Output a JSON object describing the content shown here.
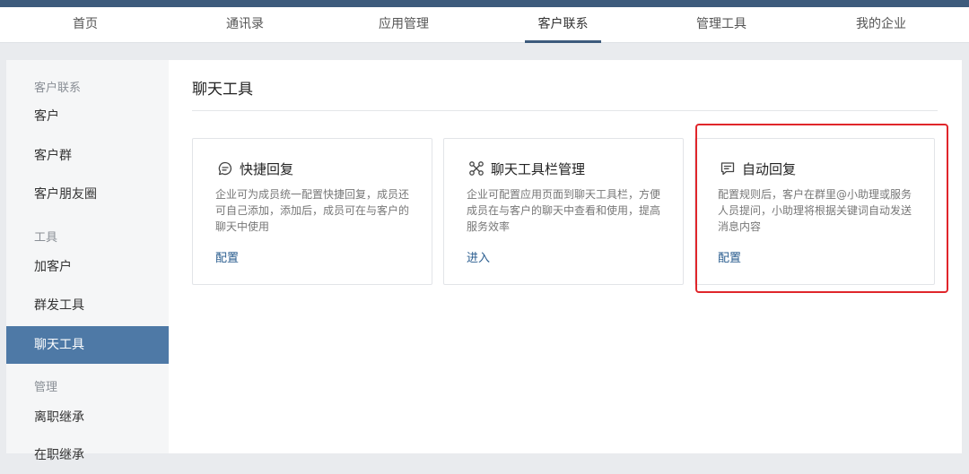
{
  "nav": {
    "items": [
      {
        "label": "首页"
      },
      {
        "label": "通讯录"
      },
      {
        "label": "应用管理"
      },
      {
        "label": "客户联系"
      },
      {
        "label": "管理工具"
      },
      {
        "label": "我的企业"
      }
    ],
    "active_index": 3
  },
  "sidebar": {
    "section_customer": "客户联系",
    "customer": "客户",
    "customer_group": "客户群",
    "moments": "客户朋友圈",
    "section_tools": "工具",
    "add_customer": "加客户",
    "group_send": "群发工具",
    "chat_tools": "聊天工具",
    "section_manage": "管理",
    "resign_inherit": "离职继承",
    "onjob_inherit": "在职继承"
  },
  "main": {
    "title": "聊天工具",
    "cards": [
      {
        "title": "快捷回复",
        "desc": "企业可为成员统一配置快捷回复，成员还可自己添加，添加后，成员可在与客户的聊天中使用",
        "link": "配置",
        "icon": "chat-bubble-icon"
      },
      {
        "title": "聊天工具栏管理",
        "desc": "企业可配置应用页面到聊天工具栏，方便成员在与客户的聊天中查看和使用，提高服务效率",
        "link": "进入",
        "icon": "tools-grid-icon"
      },
      {
        "title": "自动回复",
        "desc": "配置规则后，客户在群里@小助理或服务人员提问，小助理将根据关键词自动发送消息内容",
        "link": "配置",
        "icon": "message-box-icon"
      }
    ]
  },
  "colors": {
    "header": "#3d5b7c",
    "active_sidebar": "#4e79a6",
    "link": "#2a5d8f",
    "highlight": "#e0262b"
  }
}
